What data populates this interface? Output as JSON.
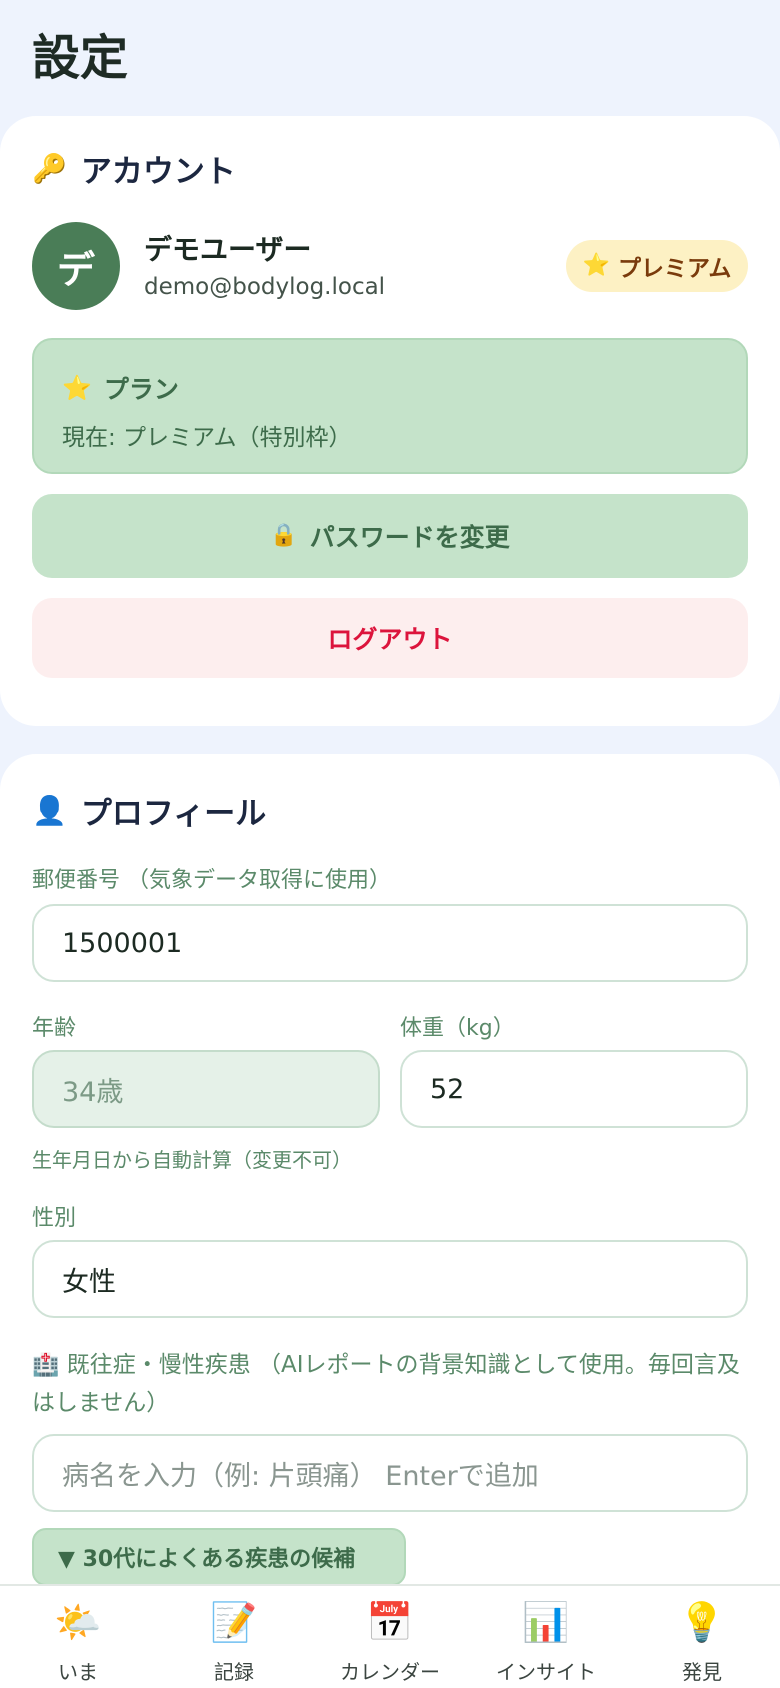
{
  "page": {
    "title": "設定"
  },
  "account": {
    "section_title": "アカウント",
    "section_icon": "🔑",
    "avatar_initial": "デ",
    "user_name": "デモユーザー",
    "email": "demo@bodylog.local",
    "badge_icon": "⭐",
    "badge_label": "プレミアム",
    "plan": {
      "icon": "⭐",
      "title": "プラン",
      "current": "現在: プレミアム（特別枠）"
    },
    "change_password": {
      "icon": "🔒",
      "label": "パスワードを変更"
    },
    "logout_label": "ログアウト"
  },
  "profile": {
    "section_title": "プロフィール",
    "section_icon": "👤",
    "postal_label": "郵便番号 （気象データ取得に使用）",
    "postal_value": "1500001",
    "age_label": "年齢",
    "age_value": "34歳",
    "age_hint": "生年月日から自動計算（変更不可）",
    "weight_label": "体重（kg）",
    "weight_value": "52",
    "gender_label": "性別",
    "gender_value": "女性",
    "disease_icon": "🏥",
    "disease_label": "既往症・慢性疾患 （AIレポートの背景知識として使用。毎回言及はしません）",
    "disease_placeholder": "病名を入力（例: 片頭痛） Enterで追加",
    "candidates_label": "▼ 30代によくある疾患の候補"
  },
  "nav": {
    "items": [
      {
        "icon": "🌤️",
        "label": "いま"
      },
      {
        "icon": "📝",
        "label": "記録"
      },
      {
        "icon": "📅",
        "label": "カレンダー"
      },
      {
        "icon": "📊",
        "label": "インサイト"
      },
      {
        "icon": "💡",
        "label": "発見"
      }
    ]
  },
  "colors": {
    "accent_green": "#3d6b4a",
    "light_green": "#c5e3ca",
    "logout_red": "#dc143c",
    "premium_bg": "#fdf1c4",
    "page_bg": "#eef3fd"
  }
}
